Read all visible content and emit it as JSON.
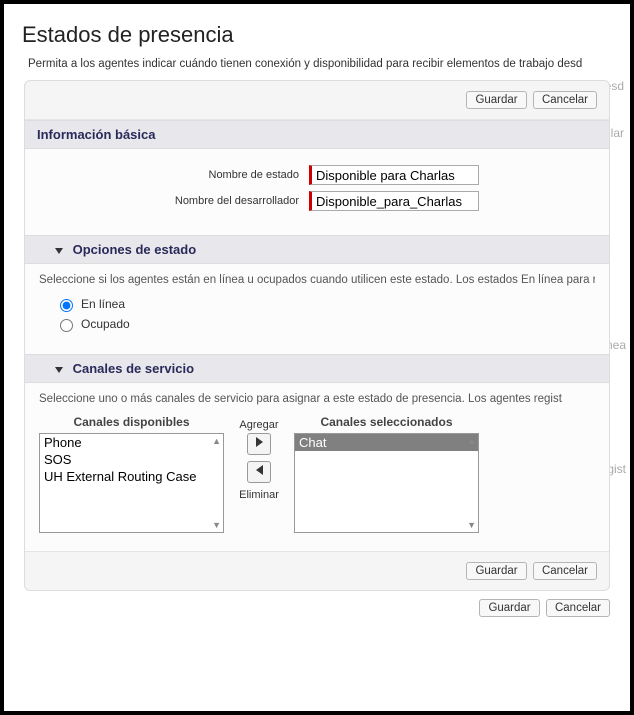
{
  "page": {
    "title": "Estados de presencia",
    "description": "Permita a los agentes indicar cuándo tienen conexión y disponibilidad para recibir elementos de trabajo desd"
  },
  "ghost": {
    "desd": "desd",
    "lar": "lar",
    "en_linea": "n línea",
    "regist": "regist"
  },
  "buttons": {
    "save": "Guardar",
    "cancel": "Cancelar"
  },
  "sections": {
    "basic": {
      "title": "Información básica",
      "field_state_name_label": "Nombre de estado",
      "field_state_name_value": "Disponible para Charlas",
      "field_dev_name_label": "Nombre del desarrollador",
      "field_dev_name_value": "Disponible_para_Charlas"
    },
    "options": {
      "title": "Opciones de estado",
      "help": "Seleccione si los agentes están en línea u ocupados cuando utilicen este estado. Los estados En línea para recibir elementos de trabajo.",
      "online_label": "En línea",
      "busy_label": "Ocupado"
    },
    "channels": {
      "title": "Canales de servicio",
      "help": "Seleccione uno o más canales de servicio para asignar a este estado de presencia. Los agentes regist",
      "available_label": "Canales disponibles",
      "selected_label": "Canales seleccionados",
      "add_label": "Agregar",
      "remove_label": "Eliminar",
      "available": [
        "Phone",
        "SOS",
        "UH External Routing Case"
      ],
      "selected": [
        "Chat"
      ]
    }
  }
}
